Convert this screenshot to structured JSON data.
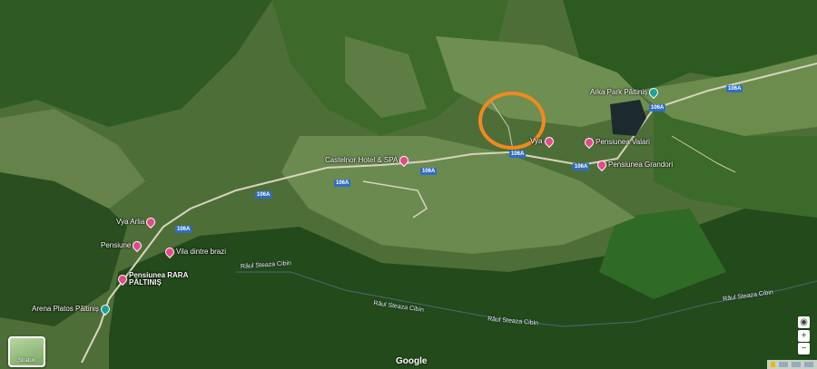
{
  "places": [
    {
      "id": "arka",
      "name": "Arka Park Păltiniș",
      "icon": "teal-pin-icon"
    },
    {
      "id": "castelnor",
      "name": "Castelnor Hotel & SPA",
      "icon": "hotel-pin-icon"
    },
    {
      "id": "valari",
      "name": "Pensiunea Valari",
      "icon": "hotel-pin-icon"
    },
    {
      "id": "grandori",
      "name": "Pensiunea Grandori",
      "icon": "hotel-pin-icon"
    },
    {
      "id": "vya",
      "name": "Vya",
      "icon": "hotel-pin-icon"
    },
    {
      "id": "arlia",
      "name": "Vya Arlia",
      "icon": "hotel-pin-icon"
    },
    {
      "id": "pensiune",
      "name": "Pensiune",
      "icon": "hotel-pin-icon"
    },
    {
      "id": "vila",
      "name": "Vila dintre brazi",
      "icon": "hotel-pin-icon"
    },
    {
      "id": "rara",
      "name": "Pensiunea RARA PĂLTINIȘ",
      "icon": "hotel-pin-icon"
    },
    {
      "id": "arena",
      "name": "Arena Platos Păltiniș",
      "icon": "teal-pin-icon"
    }
  ],
  "road_label": "106A",
  "rivers": [
    "Râul Steaza Cibin",
    "Râul Steaza Cibin",
    "Râul Steaza Cibin",
    "Râul Steaza Cibin"
  ],
  "layers_label": "Straturi",
  "brand": "Google",
  "controls": {
    "locate": "◉",
    "zoom_in": "+",
    "zoom_out": "−"
  },
  "colors": {
    "highlight": "#f08a1e",
    "pin": "#e24a8a",
    "road_shield": "#2f6ec4"
  }
}
